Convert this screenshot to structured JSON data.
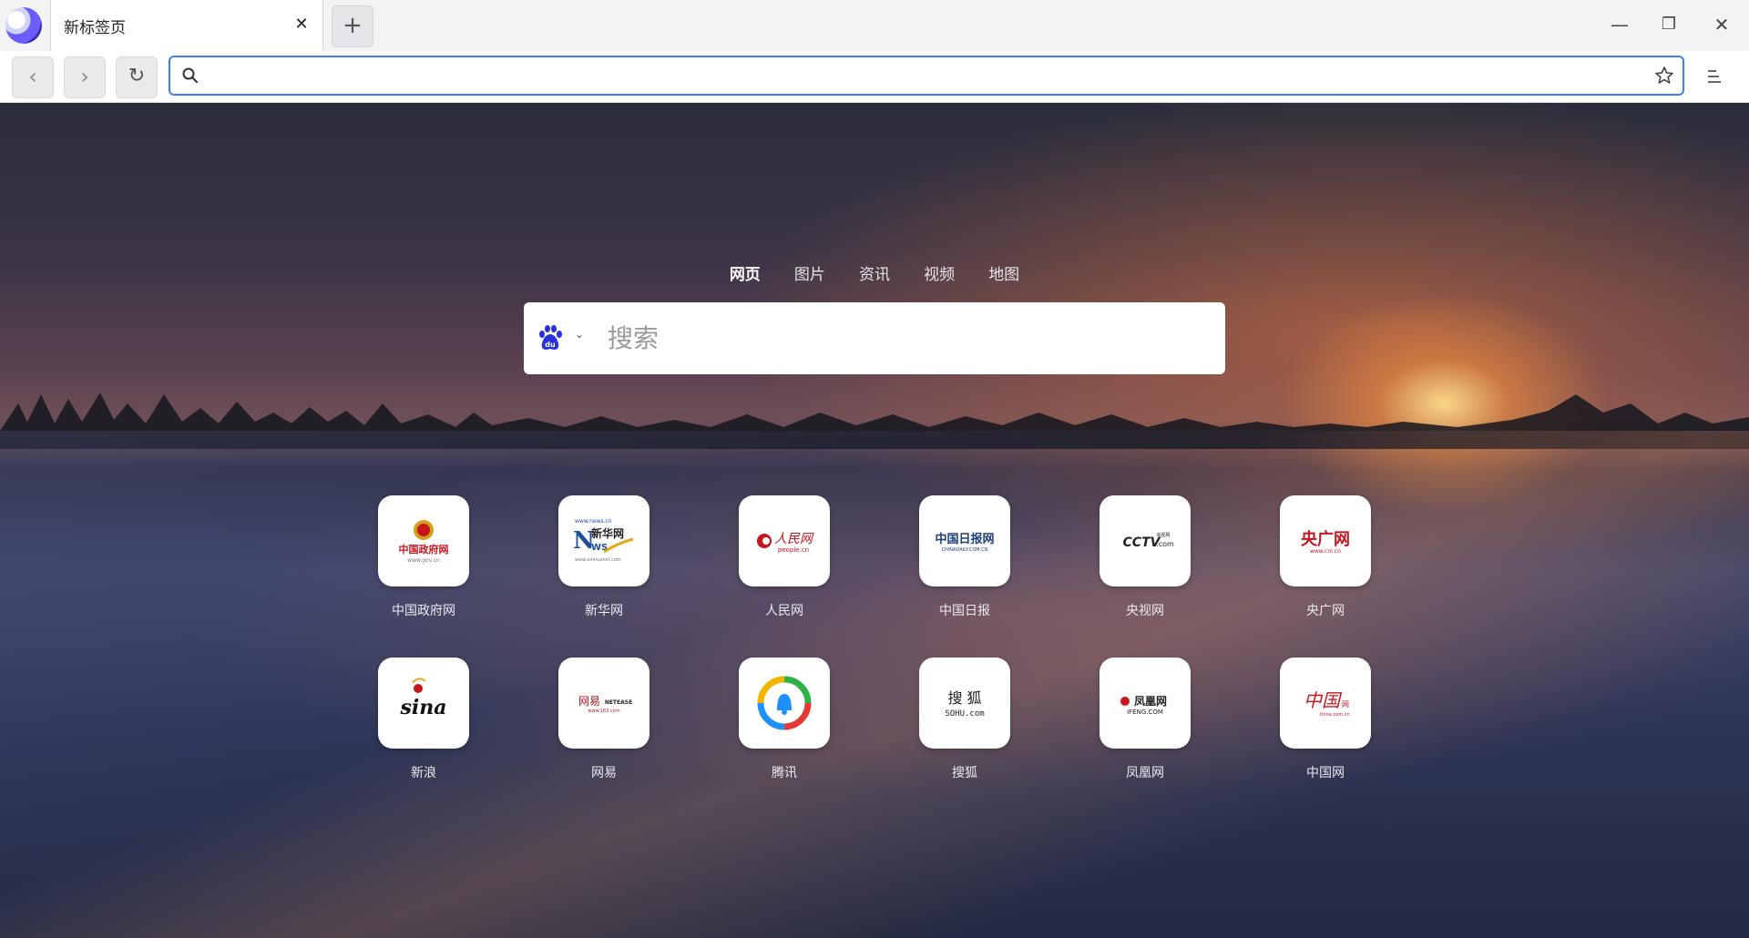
{
  "tab": {
    "title": "新标签页",
    "close": "✕"
  },
  "new_tab_label": "+",
  "window": {
    "minimize": "—",
    "restore": "❐",
    "close": "✕"
  },
  "nav": {
    "back": "‹",
    "forward": "›",
    "reload": "↻"
  },
  "address_bar": {
    "value": "",
    "placeholder": ""
  },
  "search": {
    "tabs": [
      "网页",
      "图片",
      "资讯",
      "视频",
      "地图"
    ],
    "active_tab": "网页",
    "engine_icon": "baidu-icon",
    "placeholder": "搜索"
  },
  "shortcuts": [
    {
      "label": "中国政府网",
      "logo_text": "中国政府网",
      "logo_sub": "www.gov.cn",
      "color": "#c8161d"
    },
    {
      "label": "新华网",
      "logo_text": "新华网",
      "logo_sub": "NEWS",
      "color": "#1b4f9c"
    },
    {
      "label": "人民网",
      "logo_text": "人民网",
      "logo_sub": "people.cn",
      "color": "#c8161d"
    },
    {
      "label": "中国日报",
      "logo_text": "中国日报网",
      "logo_sub": "CHINADAILY.COM.CN",
      "color": "#1c3f78"
    },
    {
      "label": "央视网",
      "logo_text": "CCTV",
      "logo_sub": ".com",
      "color": "#222222"
    },
    {
      "label": "央广网",
      "logo_text": "央广网",
      "logo_sub": "www.cnr.cn",
      "color": "#c8161d"
    },
    {
      "label": "新浪",
      "logo_text": "sina",
      "logo_sub": "",
      "color": "#111111"
    },
    {
      "label": "网易",
      "logo_text": "网易",
      "logo_sub": "www.163.com",
      "color": "#c8161d"
    },
    {
      "label": "腾讯",
      "logo_text": "",
      "logo_sub": "",
      "color": "#1e90ff"
    },
    {
      "label": "搜狐",
      "logo_text": "搜狐",
      "logo_sub": "SOHU.com",
      "color": "#222222"
    },
    {
      "label": "凤凰网",
      "logo_text": "凤凰网",
      "logo_sub": "IFENG.COM",
      "color": "#c8161d"
    },
    {
      "label": "中国网",
      "logo_text": "中国网",
      "logo_sub": "china.com.cn",
      "color": "#c8161d"
    }
  ]
}
